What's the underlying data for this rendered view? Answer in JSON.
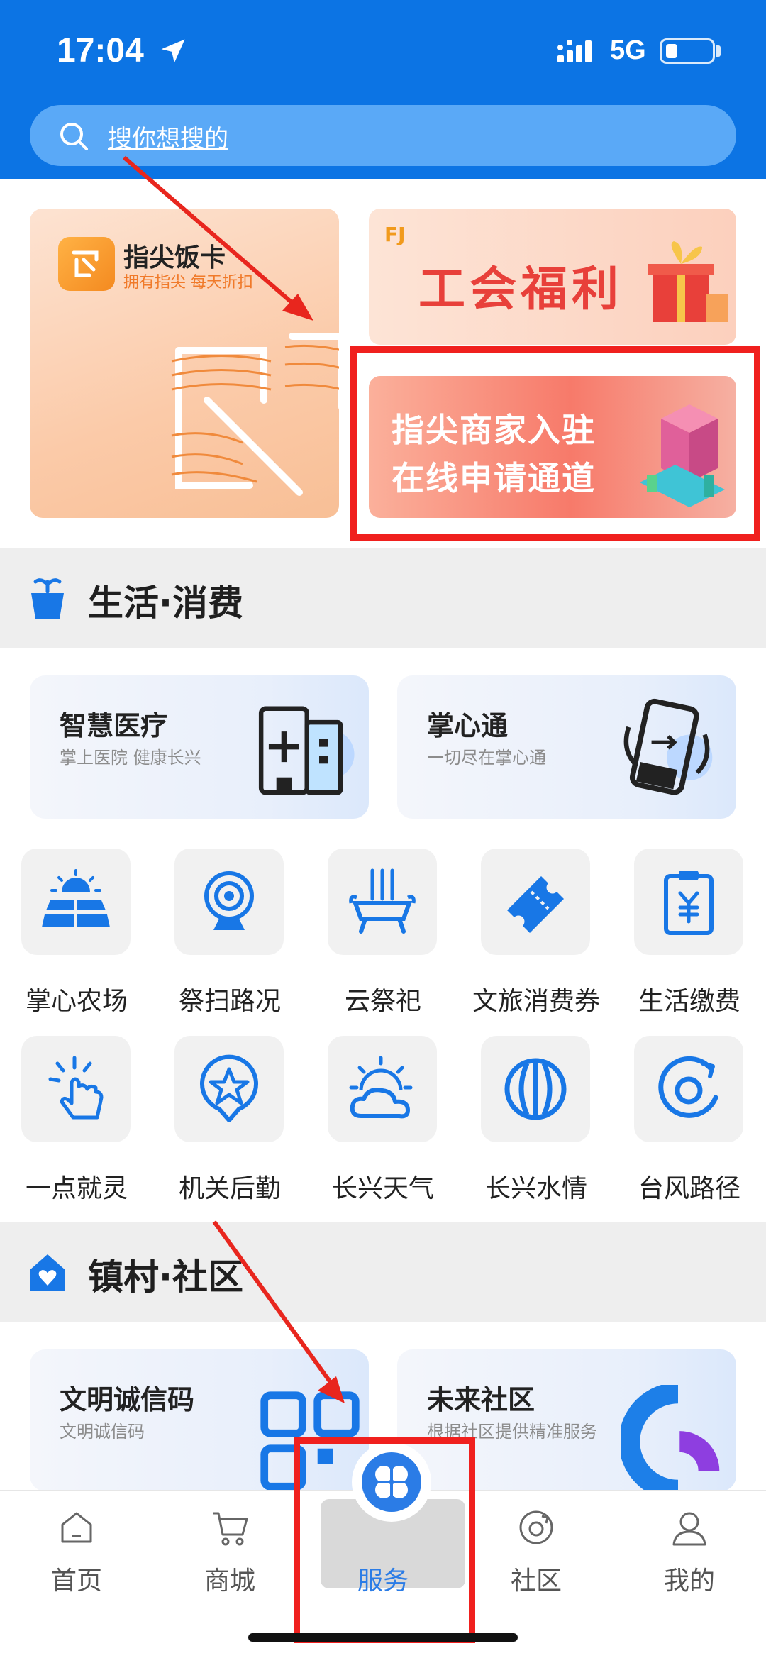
{
  "status": {
    "time": "17:04",
    "network": "5G"
  },
  "search": {
    "placeholder": "搜你想搜的"
  },
  "banners": {
    "left": {
      "title": "指尖饭卡",
      "subtitle": "拥有指尖 每天折扣"
    },
    "top_right": {
      "text": "工会福利",
      "brand": "FJ"
    },
    "bottom_right": {
      "line1": "指尖商家入驻",
      "line2": "在线申请通道"
    }
  },
  "sections": {
    "life": {
      "title": "生活·消费"
    },
    "community": {
      "title": "镇村·社区"
    }
  },
  "cards": {
    "medical": {
      "title": "智慧医疗",
      "subtitle": "掌上医院 健康长兴"
    },
    "palm": {
      "title": "掌心通",
      "subtitle": "一切尽在掌心通"
    },
    "civil": {
      "title": "文明诚信码",
      "subtitle": "文明诚信码"
    },
    "future": {
      "title": "未来社区",
      "subtitle": "根据社区提供精准服务"
    }
  },
  "grid": [
    {
      "label": "掌心农场",
      "icon": "farm-icon"
    },
    {
      "label": "祭扫路况",
      "icon": "camera-icon"
    },
    {
      "label": "云祭祀",
      "icon": "incense-icon"
    },
    {
      "label": "文旅消费券",
      "icon": "ticket-icon"
    },
    {
      "label": "生活缴费",
      "icon": "bill-icon"
    },
    {
      "label": "一点就灵",
      "icon": "tap-icon"
    },
    {
      "label": "机关后勤",
      "icon": "star-pin-icon"
    },
    {
      "label": "长兴天气",
      "icon": "weather-icon"
    },
    {
      "label": "长兴水情",
      "icon": "water-icon"
    },
    {
      "label": "台风路径",
      "icon": "typhoon-icon"
    }
  ],
  "nav": [
    {
      "label": "首页",
      "icon": "home-icon"
    },
    {
      "label": "商城",
      "icon": "cart-icon"
    },
    {
      "label": "服务",
      "icon": "service-icon",
      "active": true
    },
    {
      "label": "社区",
      "icon": "community-icon"
    },
    {
      "label": "我的",
      "icon": "user-icon"
    }
  ],
  "colors": {
    "primary": "#0c74e4",
    "accent": "#2b7ce6",
    "highlight": "#f0201e"
  }
}
